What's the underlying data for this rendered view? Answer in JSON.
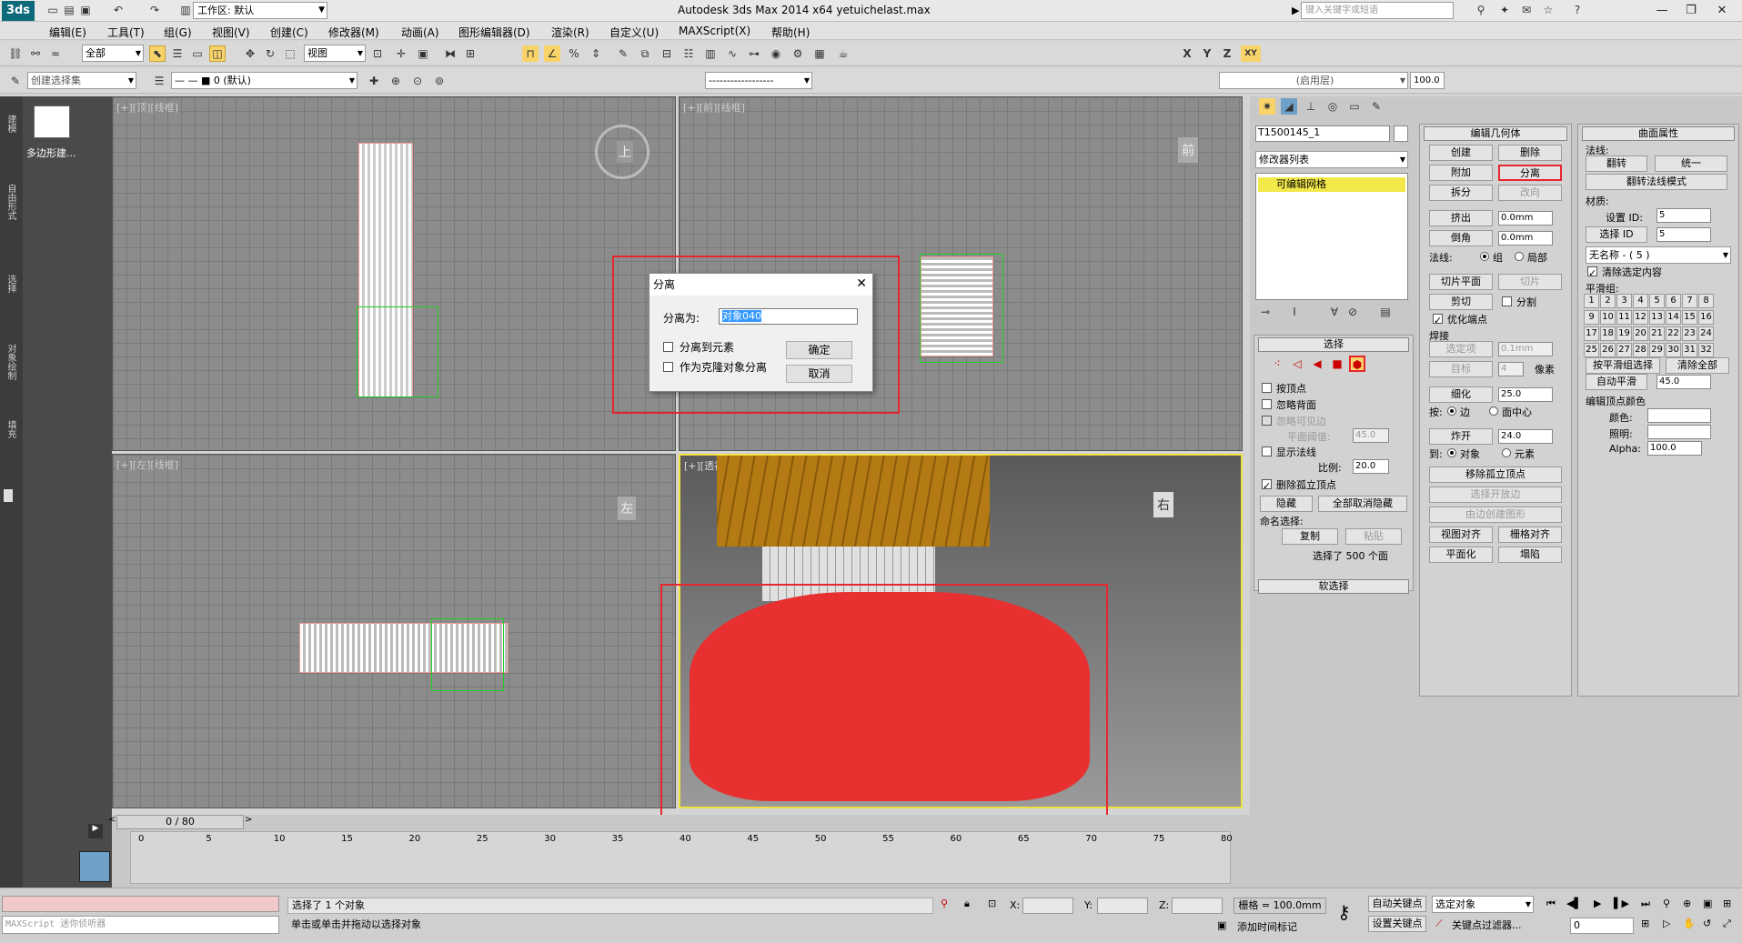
{
  "app": {
    "logo": "3ds",
    "workspace": "工作区: 默认",
    "title": "Autodesk 3ds Max  2014 x64     yetuichelast.max",
    "search_placeholder": "键入关键字或短语"
  },
  "menu": [
    "编辑(E)",
    "工具(T)",
    "组(G)",
    "视图(V)",
    "创建(C)",
    "修改器(M)",
    "动画(A)",
    "图形编辑器(D)",
    "渲染(R)",
    "自定义(U)",
    "MAXScript(X)",
    "帮助(H)"
  ],
  "toolbar1": {
    "filter": "全部",
    "refcoord": "视图",
    "axes": [
      "X",
      "Y",
      "Z",
      "XY"
    ]
  },
  "toolbar2": {
    "selset": "创建选择集",
    "layer": "0 (默认)",
    "layer_field": "(启用层)",
    "zoom": "100.0"
  },
  "leftstrip": [
    "建模",
    "自由形式",
    "选择",
    "对象绘制",
    "填充"
  ],
  "leftpanel": {
    "label": "多边形建..."
  },
  "viewports": {
    "top": {
      "label": "[+][顶][线框]",
      "cube": "上"
    },
    "front": {
      "label": "[+][前][线框]",
      "cube": "前"
    },
    "left": {
      "label": "[+][左][线框]",
      "cube": "左"
    },
    "persp": {
      "label": "[+][透视][真实+边面]",
      "cube": "右"
    }
  },
  "dialog": {
    "title": "分离",
    "name_label": "分离为:",
    "name_value": "对象040",
    "check1": "分离到元素",
    "check2": "作为克隆对象分离",
    "ok": "确定",
    "cancel": "取消"
  },
  "modify": {
    "object_name": "T1500145_1",
    "modlist": "修改器列表",
    "stack_item": "可编辑网格"
  },
  "selection": {
    "title": "选择",
    "by_vertex": "按顶点",
    "ignore_back": "忽略背面",
    "ignore_visible": "忽略可见边",
    "plane_thresh": "平面阈值:",
    "plane_val": "45.0",
    "show_normals": "显示法线",
    "scale": "比例:",
    "scale_val": "20.0",
    "delete_iso": "删除孤立顶点",
    "hide": "隐藏",
    "unhide_all": "全部取消隐藏",
    "named_sel": "命名选择:",
    "copy": "复制",
    "paste": "粘贴",
    "sel_info": "选择了 500 个面",
    "soft_sel": "软选择"
  },
  "editgeo": {
    "title": "编辑几何体",
    "create": "创建",
    "delete": "删除",
    "attach": "附加",
    "detach": "分离",
    "divide": "拆分",
    "turn": "改向",
    "extrude": "挤出",
    "extrude_val": "0.0mm",
    "chamfer": "倒角",
    "chamfer_val": "0.0mm",
    "normal": "法线:",
    "group": "组",
    "local": "局部",
    "slice_plane": "切片平面",
    "slice": "切片",
    "cut": "剪切",
    "split": "分割",
    "refine_ends": "优化端点",
    "weld": "焊接",
    "selected": "选定项",
    "weld_val": "0.1mm",
    "target": "目标",
    "target_val": "4",
    "pixels": "像素",
    "tessellate": "细化",
    "tess_val": "25.0",
    "by": "按:",
    "edge": "边",
    "face_center": "面中心",
    "explode": "炸开",
    "explode_val": "24.0",
    "to": "到:",
    "object": "对象",
    "element": "元素",
    "remove_iso": "移除孤立顶点",
    "select_open": "选择开放边",
    "create_shape": "由边创建图形",
    "view_align": "视图对齐",
    "grid_align": "栅格对齐",
    "make_planar": "平面化",
    "collapse": "塌陷"
  },
  "surface": {
    "title": "曲面属性",
    "normals": "法线:",
    "flip": "翻转",
    "unify": "统一",
    "flip_mode": "翻转法线模式",
    "material": "材质:",
    "set_id": "设置 ID:",
    "set_id_val": "5",
    "select_id": "选择 ID",
    "select_id_val": "5",
    "no_name": "无名称 - ( 5 )",
    "clear_sel": "清除选定内容",
    "smoothing": "平滑组:",
    "groups": [
      "1",
      "2",
      "3",
      "4",
      "5",
      "6",
      "7",
      "8",
      "9",
      "10",
      "11",
      "12",
      "13",
      "14",
      "15",
      "16",
      "17",
      "18",
      "19",
      "20",
      "21",
      "22",
      "23",
      "24",
      "25",
      "26",
      "27",
      "28",
      "29",
      "30",
      "31",
      "32"
    ],
    "sel_by_sg": "按平滑组选择",
    "clear_all": "清除全部",
    "auto_smooth": "自动平滑",
    "auto_val": "45.0",
    "vertex_colors": "编辑顶点颜色",
    "color": "颜色:",
    "illum": "照明:",
    "alpha": "Alpha:",
    "alpha_val": "100.0"
  },
  "timeline": {
    "frame": "0 / 80",
    "ticks": [
      "0",
      "5",
      "10",
      "15",
      "20",
      "25",
      "30",
      "35",
      "40",
      "45",
      "50",
      "55",
      "60",
      "65",
      "70",
      "75",
      "80"
    ]
  },
  "status": {
    "maxscript": "MAXScript 迷你侦听器",
    "selected": "选择了 1 个对象",
    "hint": "单击或单击并拖动以选择对象",
    "x_label": "X:",
    "y_label": "Y:",
    "z_label": "Z:",
    "grid": "栅格 = 100.0mm",
    "autokey": "自动关键点",
    "setkey": "设置关键点",
    "keymode": "选定对象",
    "keyfilters": "关键点过滤器...",
    "add_tag": "添加时间标记",
    "frame_field": "0"
  }
}
